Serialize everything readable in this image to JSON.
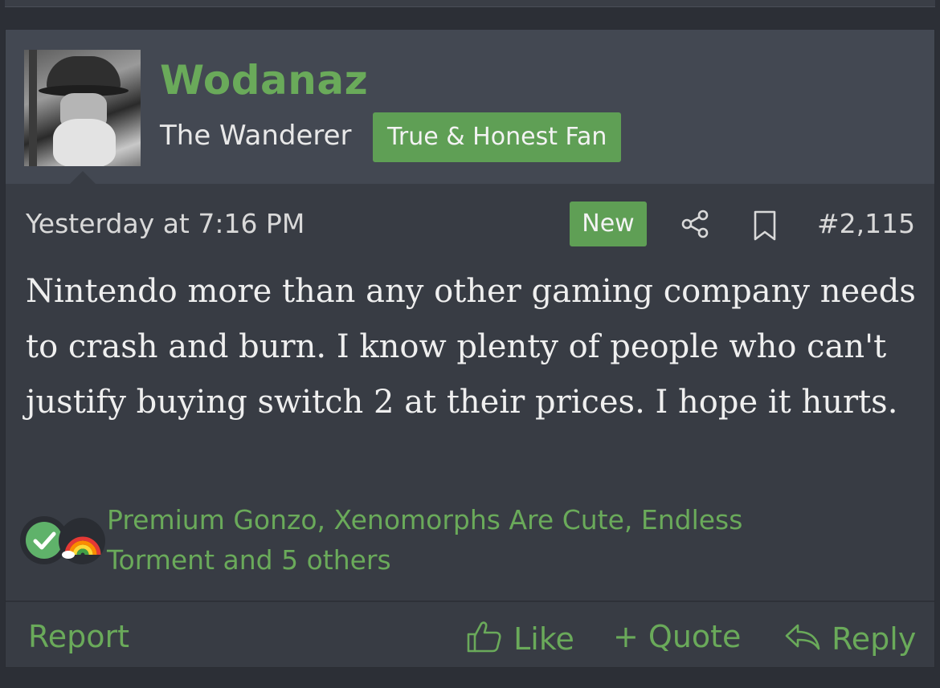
{
  "post": {
    "author": "Wodanaz",
    "user_title": "The Wanderer",
    "user_badge": "True & Honest Fan",
    "timestamp": "Yesterday at 7:16 PM",
    "new_badge": "New",
    "post_number": "#2,115",
    "body": "Nintendo more than any other gaming company needs to crash and burn. I know plenty of people who can't justify buying switch 2 at their prices. I hope it hurts.",
    "reactions_text": "Premium Gonzo, Xenomorphs Are Cute, Endless Torment and 5 others",
    "reaction_icons": [
      "checkmark-icon",
      "rainbow-icon"
    ]
  },
  "actions": {
    "report": "Report",
    "like": "Like",
    "quote": "+ Quote",
    "reply": "Reply"
  },
  "colors": {
    "accent_green": "#6aaa5a",
    "badge_green": "#5f9f55",
    "post_bg": "#383c44",
    "header_bg": "#434852"
  }
}
